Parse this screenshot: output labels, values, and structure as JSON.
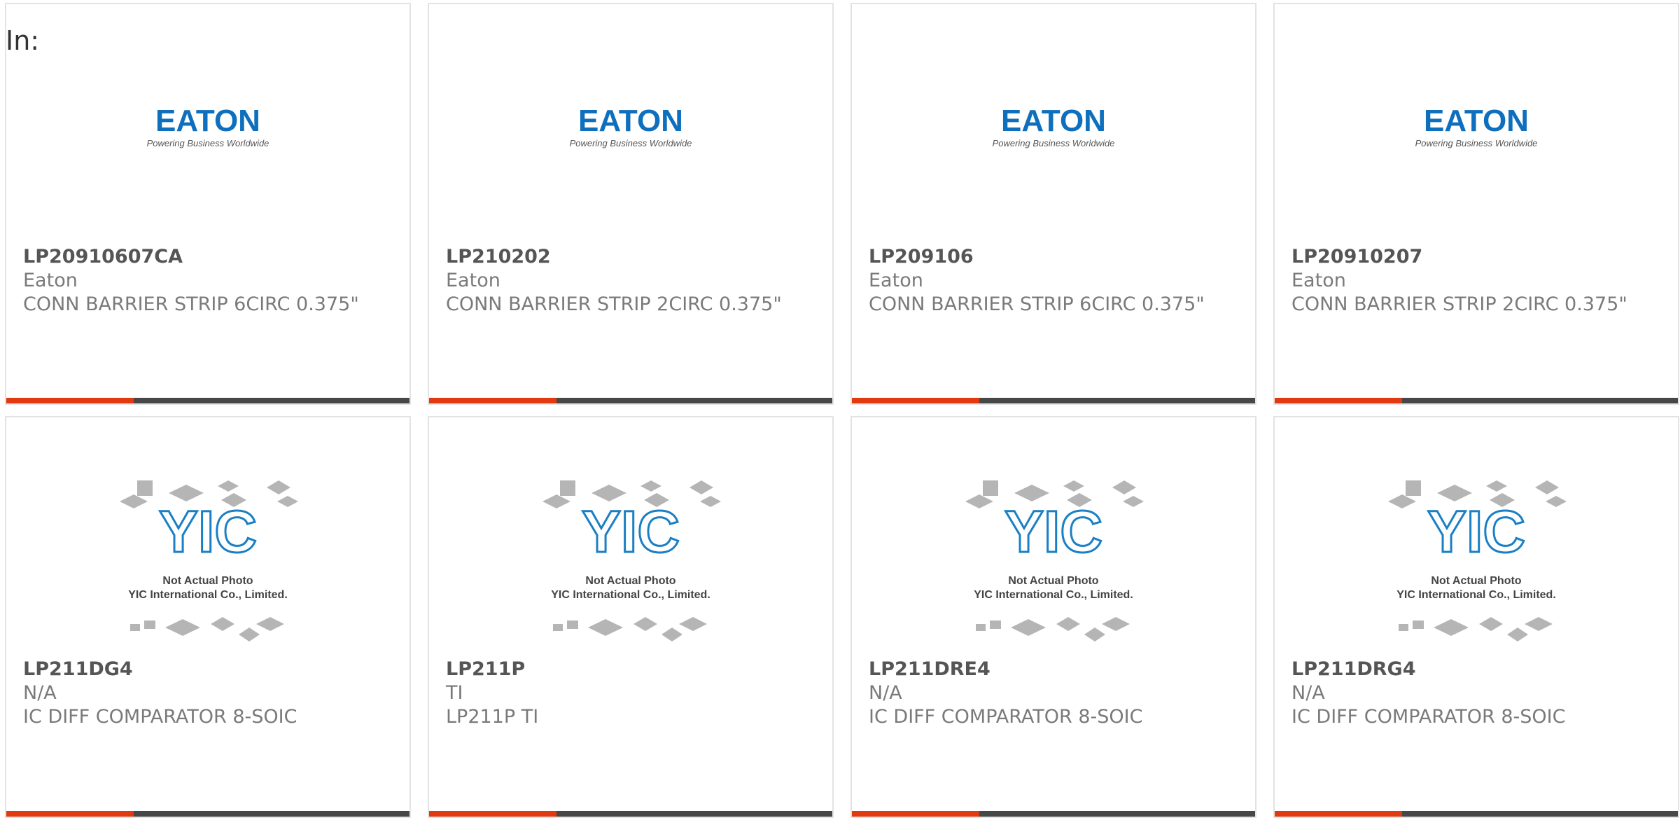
{
  "page": {
    "label": "In:"
  },
  "products": [
    {
      "part": "LP20910607CA",
      "maker": "Eaton",
      "desc": "CONN BARRIER STRIP 6CIRC 0.375\"",
      "image": "eaton-logo"
    },
    {
      "part": "LP210202",
      "maker": "Eaton",
      "desc": "CONN BARRIER STRIP 2CIRC 0.375\"",
      "image": "eaton-logo"
    },
    {
      "part": "LP209106",
      "maker": "Eaton",
      "desc": "CONN BARRIER STRIP 6CIRC 0.375\"",
      "image": "eaton-logo"
    },
    {
      "part": "LP20910207",
      "maker": "Eaton",
      "desc": "CONN BARRIER STRIP 2CIRC 0.375\"",
      "image": "eaton-logo"
    },
    {
      "part": "LP211DG4",
      "maker": "N/A",
      "desc": "IC DIFF COMPARATOR 8-SOIC",
      "image": "yic-placeholder"
    },
    {
      "part": "LP211P",
      "maker": "TI",
      "desc": "LP211P TI",
      "image": "yic-placeholder"
    },
    {
      "part": "LP211DRE4",
      "maker": "N/A",
      "desc": "IC DIFF COMPARATOR 8-SOIC",
      "image": "yic-placeholder"
    },
    {
      "part": "LP211DRG4",
      "maker": "N/A",
      "desc": "IC DIFF COMPARATOR 8-SOIC",
      "image": "yic-placeholder"
    }
  ],
  "logos": {
    "eaton": {
      "wordmark": "EATON",
      "tagline": "Powering Business Worldwide"
    },
    "yic": {
      "mark": "YIC",
      "line1": "Not Actual Photo",
      "line2": "YIC International Co., Limited."
    }
  },
  "colors": {
    "accent": "#e23a10",
    "bar": "#474747",
    "eaton_blue": "#0d6fbd",
    "yic_blue": "#1a7fc4"
  }
}
